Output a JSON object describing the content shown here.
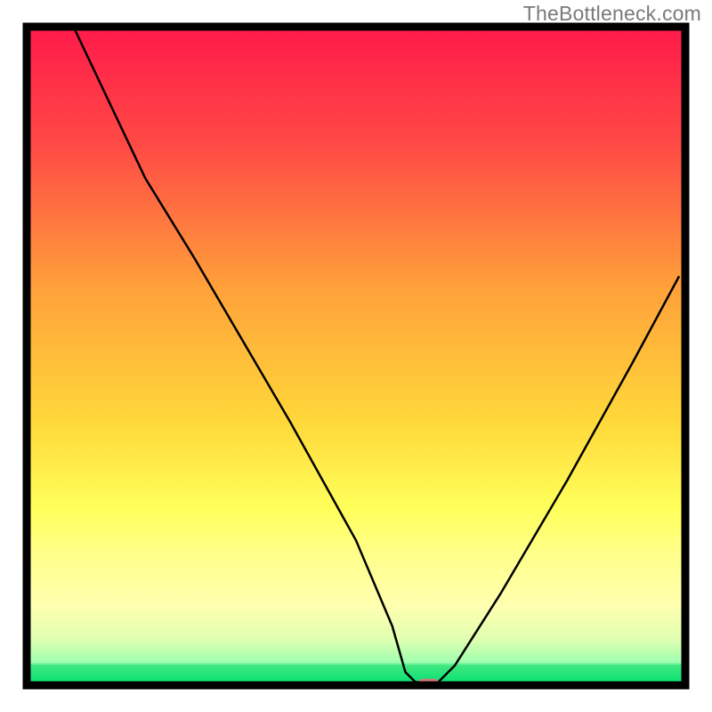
{
  "watermark": "TheBottleneck.com",
  "chart_data": {
    "type": "line",
    "title": "",
    "xlabel": "",
    "ylabel": "",
    "xlim": [
      0,
      100
    ],
    "ylim": [
      0,
      100
    ],
    "gradient_colors": {
      "top": "#ff1a4a",
      "upper_mid": "#ff7a3a",
      "mid": "#ffd83a",
      "lower_mid": "#ffff8a",
      "bottom_band": "#f0ffb0",
      "bottom": "#00e070"
    },
    "background_bands": [
      {
        "y0": 0,
        "y1": 72,
        "type": "gradient",
        "from": "#ff1a4a",
        "to": "#ffff5a"
      },
      {
        "y0": 72,
        "y1": 84,
        "type": "solid",
        "color": "#ffff8a"
      },
      {
        "y0": 84,
        "y1": 97,
        "type": "gradient",
        "from": "#ffffa0",
        "to": "#b0ff90"
      },
      {
        "y0": 97,
        "y1": 100,
        "type": "solid",
        "color": "#00e070"
      }
    ],
    "frame": {
      "stroke": "#000000",
      "stroke_width": 8
    },
    "curve": {
      "description": "V-shaped bottleneck curve; steep descent from top-left, nearly vertical plunge after knee, trough near x≈61, rising concave right arm to top-right edge",
      "points": [
        {
          "x": 7.1,
          "y": 100.0
        },
        {
          "x": 18.0,
          "y": 77.0
        },
        {
          "x": 25.5,
          "y": 64.8
        },
        {
          "x": 40.0,
          "y": 40.0
        },
        {
          "x": 50.0,
          "y": 22.0
        },
        {
          "x": 55.5,
          "y": 9.0
        },
        {
          "x": 57.5,
          "y": 2.0
        },
        {
          "x": 59.0,
          "y": 0.5
        },
        {
          "x": 61.0,
          "y": 0.3
        },
        {
          "x": 62.5,
          "y": 0.5
        },
        {
          "x": 65.0,
          "y": 3.0
        },
        {
          "x": 72.0,
          "y": 14.0
        },
        {
          "x": 82.0,
          "y": 31.0
        },
        {
          "x": 92.0,
          "y": 49.0
        },
        {
          "x": 99.0,
          "y": 62.0
        }
      ]
    },
    "marker": {
      "x": 61.0,
      "y": 0.3,
      "shape": "rounded-rect",
      "fill": "#d07a7a",
      "width": 3.2,
      "height": 1.4
    }
  }
}
